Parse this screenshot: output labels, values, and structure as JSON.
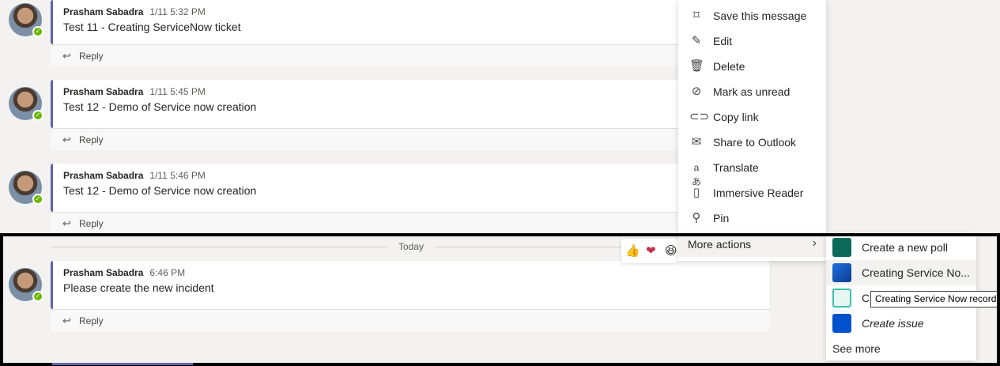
{
  "messages": [
    {
      "author": "Prasham Sabadra",
      "time": "1/11 5:32 PM",
      "text": "Test 11 - Creating ServiceNow ticket",
      "reply": "Reply"
    },
    {
      "author": "Prasham Sabadra",
      "time": "1/11 5:45 PM",
      "text": "Test 12 - Demo of Service now creation",
      "reply": "Reply"
    },
    {
      "author": "Prasham Sabadra",
      "time": "1/11 5:46 PM",
      "text": "Test 12 - Demo of Service now creation",
      "reply": "Reply"
    },
    {
      "author": "Prasham Sabadra",
      "time": "6:46 PM",
      "text": "Please create the new incident",
      "reply": "Reply"
    }
  ],
  "divider": {
    "label": "Today"
  },
  "reactions": [
    {
      "icon": "thumbs-up-icon",
      "glyph": "👍"
    },
    {
      "icon": "heart-icon",
      "glyph": "❤"
    },
    {
      "icon": "laugh-icon",
      "glyph": "😆"
    }
  ],
  "context_menu": {
    "items": [
      {
        "label": "Save this message",
        "icon": "bookmark-icon",
        "glyph": "🔖"
      },
      {
        "label": "Edit",
        "icon": "pencil-icon",
        "glyph": "✎"
      },
      {
        "label": "Delete",
        "icon": "trash-icon",
        "glyph": "🗑"
      },
      {
        "label": "Mark as unread",
        "icon": "unread-icon",
        "glyph": "⊘"
      },
      {
        "label": "Copy link",
        "icon": "link-icon",
        "glyph": "🔗"
      },
      {
        "label": "Share to Outlook",
        "icon": "mail-icon",
        "glyph": "✉"
      },
      {
        "label": "Translate",
        "icon": "translate-icon",
        "glyph": "aあ"
      },
      {
        "label": "Immersive Reader",
        "icon": "immersive-reader-icon",
        "glyph": "📖"
      },
      {
        "label": "Pin",
        "icon": "pin-icon",
        "glyph": "📌"
      }
    ],
    "more_actions": "More actions"
  },
  "submenu": {
    "items": [
      {
        "label": "Create a new poll",
        "icon": "polly-app-icon",
        "color": "#0b6a5a"
      },
      {
        "label": "Creating Service No...",
        "icon": "azure-devops-icon",
        "color": "#0b56c4"
      },
      {
        "label": "C",
        "icon": "servicenow-app-icon",
        "color": "#3ac2a8"
      },
      {
        "label": "Create issue",
        "icon": "jira-icon",
        "color": "#0052cc"
      }
    ],
    "see_more": "See more"
  },
  "tooltip": "Creating Service Now record",
  "colors": {
    "accent": "#6264a7",
    "presence": "#6bb700"
  }
}
